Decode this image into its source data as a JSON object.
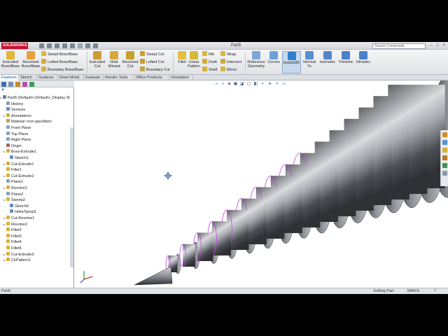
{
  "titlebar": {
    "logo_text": "SOLIDWORKS",
    "document_title": "Part5",
    "search_placeholder": "Search Commands",
    "minimize_label": "–",
    "maximize_label": "□",
    "close_label": "×"
  },
  "commands": {
    "extruded_boss_base": "Extruded Boss/Base",
    "revolved_boss_base": "Revolved Boss/Base",
    "swept_boss_base": "Swept Boss/Base",
    "lofted_boss_base": "Lofted Boss/Base",
    "boundary_boss_base": "Boundary Boss/Base",
    "extruded_cut": "Extruded Cut",
    "hole_wizard": "Hole Wizard",
    "revolved_cut": "Revolved Cut",
    "swept_cut": "Swept Cut",
    "lofted_cut": "Lofted Cut",
    "boundary_cut": "Boundary Cut",
    "fillet": "Fillet",
    "linear_pattern": "Linear Pattern",
    "rib": "Rib",
    "draft": "Draft",
    "shell": "Shell",
    "wrap": "Wrap",
    "intersect": "Intersect",
    "mirror": "Mirror",
    "reference_geometry": "Reference Geometry",
    "curves": "Curves",
    "instant3d": "Instant3D",
    "normal_to": "Normal To",
    "isometric": "Isometric",
    "trimetric": "Trimetric",
    "dimetric": "Dimetric"
  },
  "tabs": [
    "Features",
    "Sketch",
    "Surfaces",
    "Sheet Metal",
    "Evaluate",
    "Render Tools",
    "Office Products",
    "Simulation"
  ],
  "feature_tree": [
    "Part5  (Default<<Default>_Display St",
    "History",
    "Sensors",
    "Annotations",
    "Material <not specified>",
    "Front Plane",
    "Top Plane",
    "Right Plane",
    "Origin",
    "Boss-Extrude1",
    "Sketch1",
    "Cut-Extrude1",
    "Fillet1",
    "Cut-Extrude2",
    "Plane1",
    "Revolve1",
    "Plane2",
    "Sweep2",
    "Sketch6",
    "Helix/Spiral1",
    "Cut-Revolve1",
    "Revolve2",
    "Fillet2",
    "Fillet3",
    "Fillet4",
    "Fillet5",
    "Cut-Extrude3",
    "CirPattern1"
  ],
  "status": {
    "left": "Part5",
    "mode": "Editing Part",
    "units": "MMGS"
  },
  "colors": {
    "accent_blue": "#0b4e9e",
    "sketch_magenta": "#c040e0",
    "model_steel": "#8a8d92"
  }
}
